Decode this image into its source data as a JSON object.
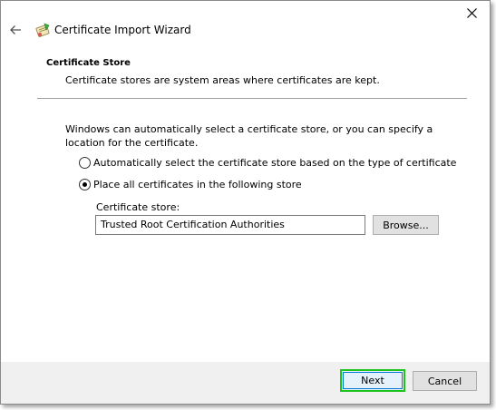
{
  "window": {
    "title": "Certificate Import Wizard",
    "close_icon": "close-icon",
    "back_icon": "back-arrow-icon",
    "wizard_icon": "certificate-wizard-icon"
  },
  "section": {
    "heading": "Certificate Store",
    "description": "Certificate stores are system areas where certificates are kept."
  },
  "body": {
    "intro": "Windows can automatically select a certificate store, or you can specify a location for the certificate.",
    "options": [
      {
        "label": "Automatically select the certificate store based on the type of certificate",
        "selected": false
      },
      {
        "label": "Place all certificates in the following store",
        "selected": true
      }
    ],
    "store_label": "Certificate store:",
    "store_value": "Trusted Root Certification Authorities",
    "browse_label": "Browse..."
  },
  "footer": {
    "next_label": "Next",
    "cancel_label": "Cancel"
  },
  "colors": {
    "highlight_border": "#1dc41d",
    "focus_border": "#0078d7"
  }
}
